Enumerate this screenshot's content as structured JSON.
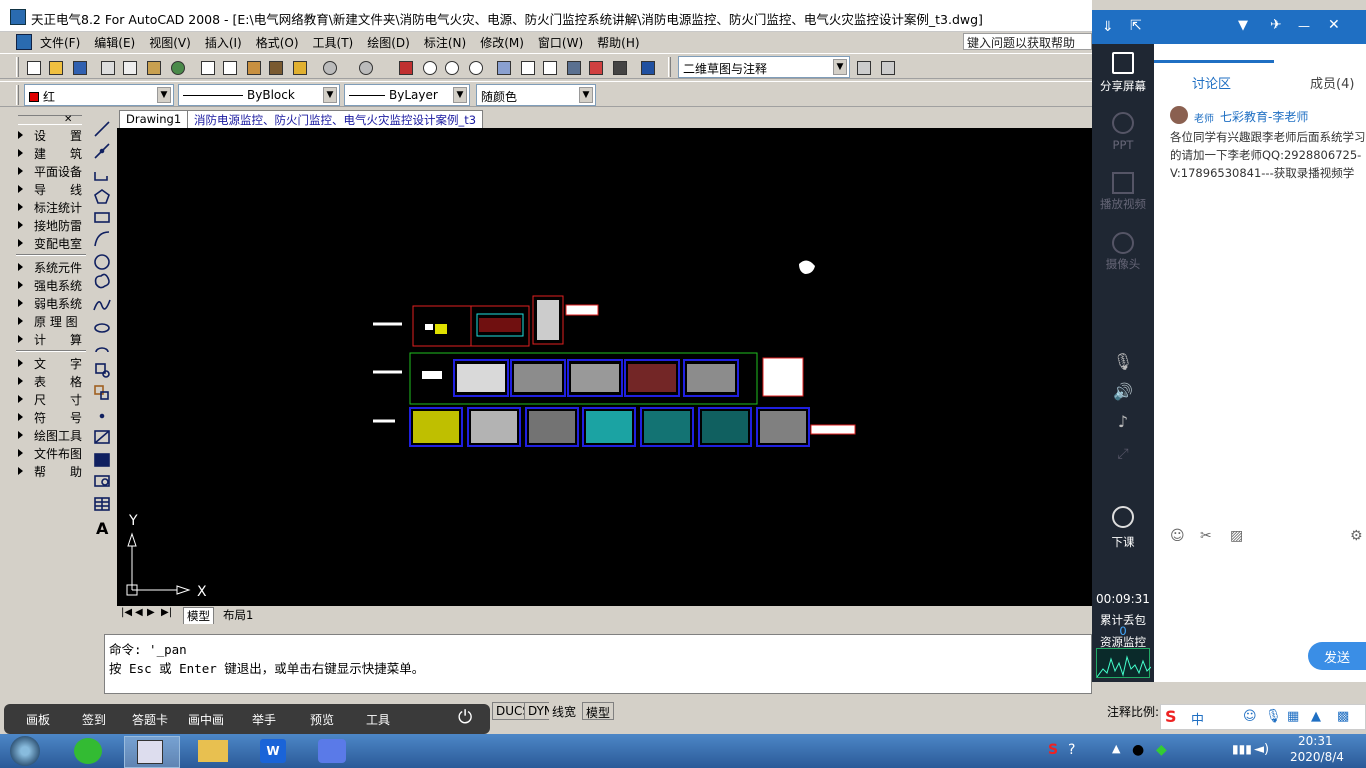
{
  "window": {
    "title": "天正电气8.2 For AutoCAD 2008 - [E:\\电气网络教育\\新建文件夹\\消防电气火灾、电源、防火门监控系统讲解\\消防电源监控、防火门监控、电气火灾监控设计案例_t3.dwg]"
  },
  "menubar": {
    "items": [
      "文件(F)",
      "编辑(E)",
      "视图(V)",
      "插入(I)",
      "格式(O)",
      "工具(T)",
      "绘图(D)",
      "标注(N)",
      "修改(M)",
      "窗口(W)",
      "帮助(H)"
    ],
    "help_placeholder": "键入问题以获取帮助"
  },
  "toolbar1": {
    "workspace": "二维草图与注释"
  },
  "toolbar2": {
    "color": "红",
    "linetype": "ByBlock",
    "lineweight": "ByLayer",
    "plotstyle": "随颜色"
  },
  "leftmenu": {
    "items": [
      "设　　置",
      "建　　筑",
      "平面设备",
      "导　　线",
      "标注统计",
      "接地防雷",
      "变配电室",
      "系统元件",
      "强电系统",
      "弱电系统",
      "原 理 图",
      "计　　算",
      "文　　字",
      "表　　格",
      "尺　　寸",
      "符　　号",
      "绘图工具",
      "文件布图",
      "帮　　助"
    ]
  },
  "doctabs": {
    "tab1": "Drawing1",
    "tab2": "消防电源监控、防火门监控、电气火灾监控设计案例_t3"
  },
  "canvas": {
    "ucs_y": "Y",
    "ucs_x": "X"
  },
  "layouttabs": {
    "model": "模型",
    "layout1": "布局1"
  },
  "cmdline": {
    "line1": "命令: '_pan",
    "line2": "按 Esc 或 Enter 键退出，或单击右键显示快捷菜单。"
  },
  "statusbar": {
    "ducs": "DUCS",
    "dyn": "DYN",
    "lwt": "线宽",
    "model": "模型",
    "scale_label": "注释比例:"
  },
  "overlay": {
    "items": [
      "画板",
      "签到",
      "答题卡",
      "画中画",
      "举手",
      "预览",
      "工具"
    ]
  },
  "sidebar": {
    "share": "分享屏幕",
    "ppt": "PPT",
    "video": "播放视频",
    "camera": "摄像头",
    "end": "下课",
    "timer": "00:09:31",
    "loss_label": "累计丢包",
    "loss_value": "0",
    "monitor": "资源监控"
  },
  "chat": {
    "tab_discuss": "讨论区",
    "tab_members": "成员(4)",
    "badge": "老师",
    "author": "七彩教育-李老师",
    "message": "各位同学有兴趣跟李老师后面系统学习的请加一下李老师QQ:2928806725-V:17896530841---获取录播视频学习，",
    "send": "发送"
  },
  "taskbar": {
    "time": "20:31",
    "date": "2020/8/4",
    "ime": "中"
  }
}
